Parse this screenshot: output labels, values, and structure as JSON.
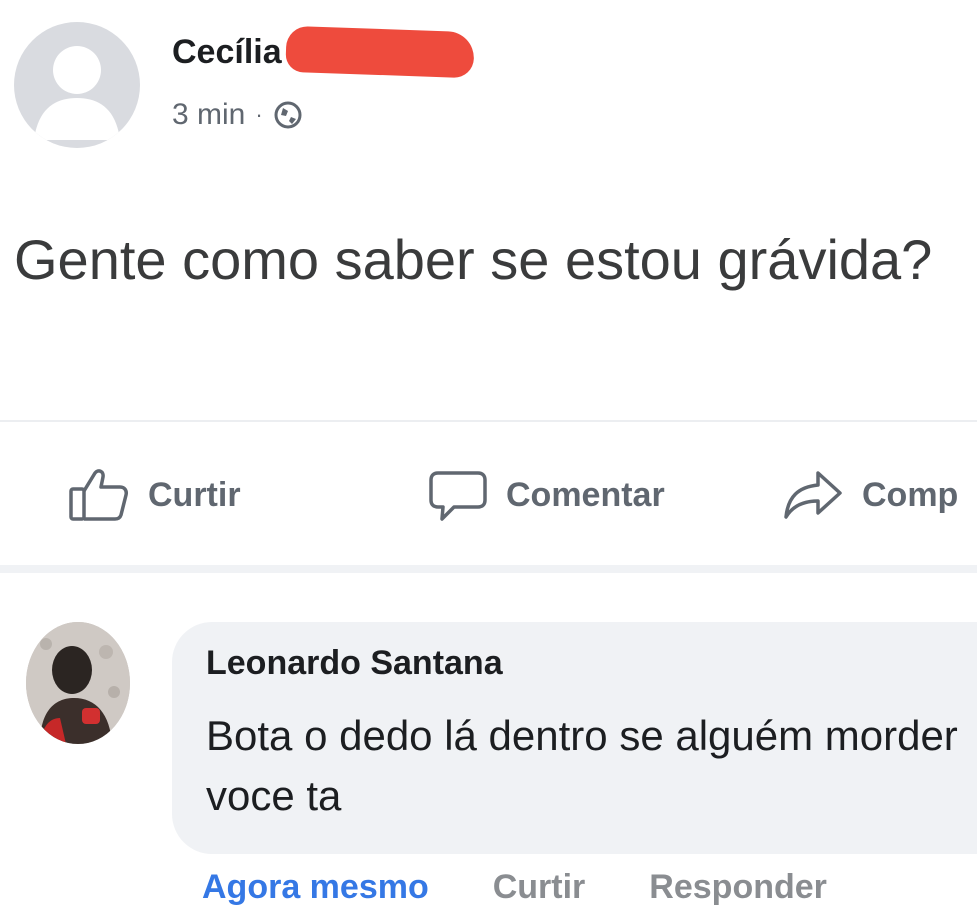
{
  "post": {
    "author": "Cecília",
    "time": "3 min",
    "separator": "·",
    "privacy_icon": "globe-icon",
    "text": "Gente como saber se estou grávida?"
  },
  "actions": {
    "like": "Curtir",
    "comment": "Comentar",
    "share": "Comp"
  },
  "comment": {
    "author": "Leonardo Santana",
    "text": "Bota o dedo lá dentro se alguém morder voce ta",
    "time": "Agora mesmo",
    "like": "Curtir",
    "reply": "Responder"
  },
  "colors": {
    "link_blue": "#3578e5",
    "muted_gray": "#606770",
    "bubble_bg": "#f0f2f5",
    "redaction_red": "#ee4b3d"
  }
}
